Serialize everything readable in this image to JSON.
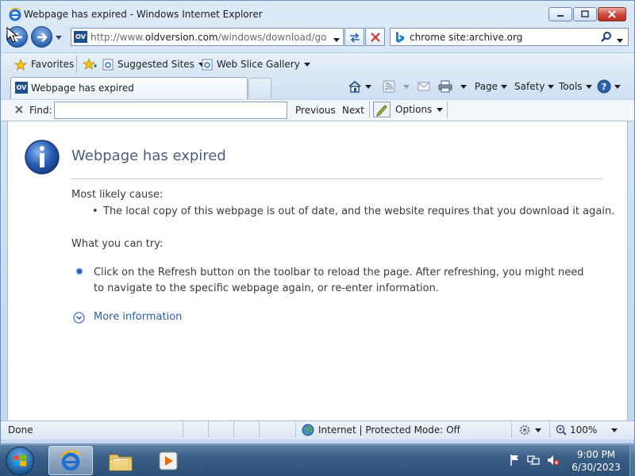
{
  "window": {
    "title": "Webpage has expired - Windows Internet Explorer"
  },
  "address_bar": {
    "url_prefix": "http://www.",
    "url_domain": "oldversion.com",
    "url_rest": "/windows/download/google",
    "favicon_text": "OV"
  },
  "search": {
    "value": "chrome site:archive.org"
  },
  "favorites_bar": {
    "favorites_label": "Favorites",
    "items": [
      "Suggested Sites",
      "Web Slice Gallery"
    ]
  },
  "tab": {
    "label": "Webpage has expired",
    "favicon_text": "OV"
  },
  "command_bar": {
    "page_label": "Page",
    "safety_label": "Safety",
    "tools_label": "Tools"
  },
  "find_bar": {
    "label": "Find:",
    "value": "",
    "previous_label": "Previous",
    "next_label": "Next",
    "options_label": "Options"
  },
  "content": {
    "title": "Webpage has expired",
    "cause_label": "Most likely cause:",
    "cause_items": [
      "The local copy of this webpage is out of date, and the website requires that you download it again."
    ],
    "try_label": "What you can try:",
    "try_items": [
      "Click on the Refresh button on the toolbar to reload the page. After refreshing, you might need to navigate to the specific webpage again, or re-enter information."
    ],
    "more_info_label": "More information"
  },
  "status_bar": {
    "status": "Done",
    "zone": "Internet | Protected Mode: Off",
    "zoom": "100%"
  },
  "taskbar": {
    "time": "9:00 PM",
    "date": "6/30/2023"
  },
  "colors": {
    "accent_blue": "#2a5fa8",
    "title_text": "#4b5d7a",
    "close_red": "#c9483a"
  }
}
